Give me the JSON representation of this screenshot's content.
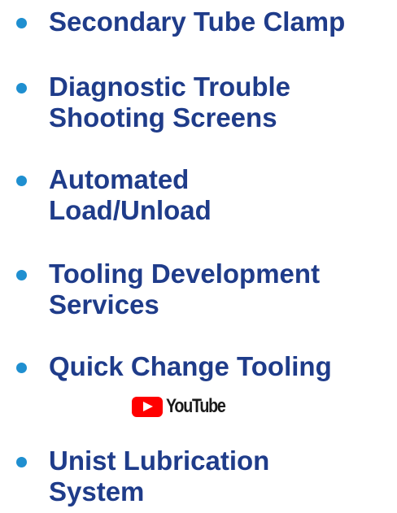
{
  "features": [
    {
      "label": "Secondary Tube Clamp"
    },
    {
      "label": "Diagnostic Trouble\nShooting Screens"
    },
    {
      "label": "Automated\nLoad/Unload"
    },
    {
      "label": "Tooling Development\nServices"
    },
    {
      "label": "Quick Change Tooling"
    },
    {
      "label": "Unist Lubrication\nSystem"
    }
  ],
  "youtube": {
    "icon": "youtube-play-icon",
    "label": "YouTube"
  },
  "colors": {
    "text": "#1f3c8a",
    "bullet": "#1f8fd0",
    "youtube_red": "#ff0000"
  }
}
